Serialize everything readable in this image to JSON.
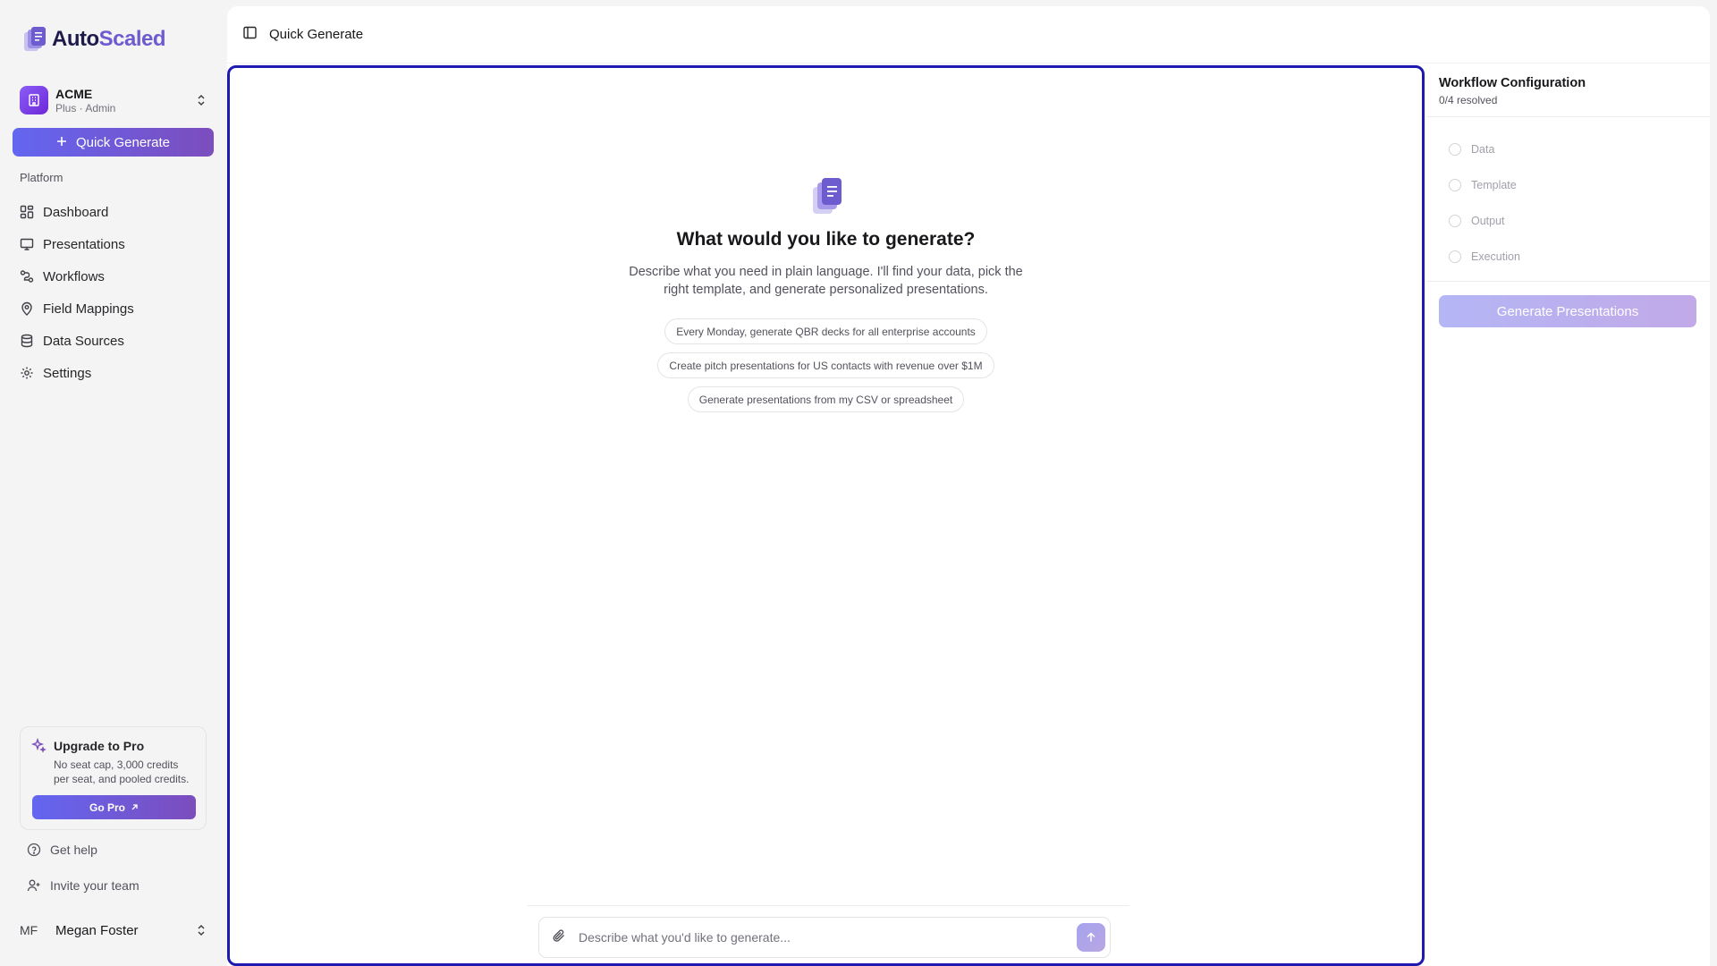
{
  "brand": {
    "name_part1": "Auto",
    "name_part2": "Scaled",
    "logo_icon": "document-stack-icon"
  },
  "org": {
    "name": "ACME",
    "subtitle": "Plus · Admin"
  },
  "sidebar": {
    "quick_generate_label": "Quick Generate",
    "section_label": "Platform",
    "items": [
      {
        "label": "Dashboard",
        "icon": "grid-icon"
      },
      {
        "label": "Presentations",
        "icon": "presentation-icon"
      },
      {
        "label": "Workflows",
        "icon": "workflow-icon"
      },
      {
        "label": "Field Mappings",
        "icon": "map-pin-icon"
      },
      {
        "label": "Data Sources",
        "icon": "database-icon"
      },
      {
        "label": "Settings",
        "icon": "gear-icon"
      }
    ],
    "upgrade": {
      "title": "Upgrade to Pro",
      "text": "No seat cap, 3,000 credits per seat, and pooled credits.",
      "button": "Go Pro"
    },
    "help_label": "Get help",
    "invite_label": "Invite your team",
    "user": {
      "initials": "MF",
      "name": "Megan Foster"
    }
  },
  "topbar": {
    "title": "Quick Generate"
  },
  "hero": {
    "title": "What would you like to generate?",
    "description": "Describe what you need in plain language. I'll find your data, pick the right template, and generate personalized presentations.",
    "suggestions": [
      "Every Monday, generate QBR decks for all enterprise accounts",
      "Create pitch presentations for US contacts with revenue over $1M",
      "Generate presentations from my CSV or spreadsheet"
    ]
  },
  "composer": {
    "placeholder": "Describe what you'd like to generate..."
  },
  "panel": {
    "title": "Workflow Configuration",
    "status": "0/4 resolved",
    "steps": [
      "Data",
      "Template",
      "Output",
      "Execution"
    ],
    "button": "Generate Presentations"
  },
  "colors": {
    "accent": "#6366f1",
    "accent_purple": "#7c4dbd",
    "focus_border": "#1e1ab0"
  }
}
